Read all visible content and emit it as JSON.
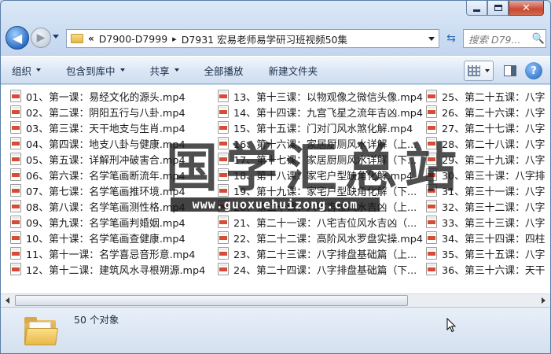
{
  "window": {
    "caption": {
      "minimize_icon": "minimize-icon",
      "maximize_icon": "maximize-icon",
      "close_glyph": "✕"
    }
  },
  "nav": {
    "back_icon": "◀",
    "forward_icon": "▶",
    "refresh_icon": "⇆",
    "breadcrumb_chevron": "«",
    "breadcrumbs": [
      "D7900-D7999",
      "D7931 宏易老师易学研习班视频50集"
    ],
    "breadcrumb_separator": "▸",
    "search_placeholder": "搜索 D79...",
    "search_icon": "🔍"
  },
  "toolbar": {
    "organize": "组织",
    "include_in_library": "包含到库中",
    "share": "共享",
    "play_all": "全部播放",
    "new_folder": "新建文件夹",
    "help": "?"
  },
  "files": {
    "columns": [
      [
        "01、第一课：易经文化的源头.mp4",
        "02、第二课：阴阳五行与八卦.mp4",
        "03、第三课：天干地支与生肖.mp4",
        "04、第四课：地支八卦与健康.mp4",
        "05、第五课：详解刑冲破害合.mp4",
        "06、第六课：名学笔画断流年.mp4",
        "07、第七课：名学笔画推环境.mp4",
        "08、第八课：名学笔画测性格.mp4",
        "09、第九课：名学笔画判婚姻.mp4",
        "10、第十课：名学笔画查健康.mp4",
        "11、第十一课：名学喜忌音形意.mp4",
        "12、第十二课：建筑风水寻根朔源.mp4"
      ],
      [
        "13、第十三课：以物观像之微信头像.mp4",
        "14、第十四课：九宫飞星之流年吉凶.mp4",
        "15、第十五课：门对门风水煞化解.mp4",
        "16、第十六课：家居厨厕风水详解（上...",
        "17、第十七课：家居厨厕风水详解（下...",
        "18、第十八课：家宅户型缺角化解.mp4",
        "19、第十九课：家宅户型缺角化解（下...",
        "20、第二十课：八宅吉位风水吉凶（上...",
        "21、第二十一课：八宅吉位风水吉凶（...",
        "22、第二十二课：高阶风水罗盘实操.mp4",
        "23、第二十三课：八字排盘基础篇（上...",
        "24、第二十四课：八字排盘基础篇（下..."
      ],
      [
        "25、第二十五课：八字",
        "26、第二十六课：八字",
        "27、第二十七课：八字",
        "28、第二十八课：八字",
        "29、第二十九课：八字",
        "30、第三十课：八字排",
        "31、第三十一课：八字",
        "32、第三十二课：八字",
        "33、第三十三课：八字",
        "34、第三十四课：四柱",
        "35、第三十五课：八字",
        "36、第三十六课：天干"
      ]
    ]
  },
  "watermark": {
    "title": "国学汇总站",
    "url": "www.guoxuehuizong.com"
  },
  "status": {
    "object_count": "50 个对象"
  },
  "colors": {
    "accent": "#2d6fc4",
    "close_button": "#c74a34",
    "file_icon_stripe": "#d84b36"
  }
}
